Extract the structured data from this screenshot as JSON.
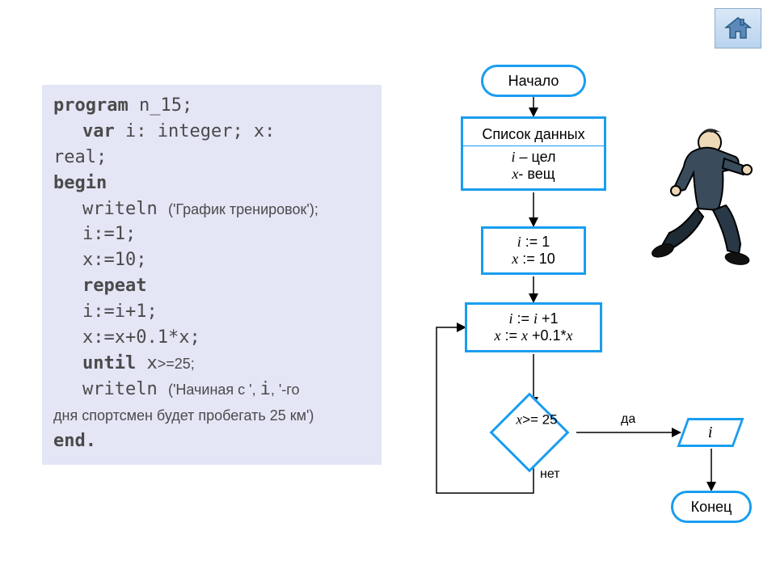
{
  "home_button": {
    "tooltip": "Домой"
  },
  "code": {
    "l1_kw": "program",
    "l1_rest": " n_15;",
    "l2_kw": "var",
    "l2_rest": " i: integer; x:",
    "l3": "real;",
    "l4_kw": "begin",
    "l5_fn": "writeln ",
    "l5_arg": "('График тренировок');",
    "l6": "i:=1;",
    "l7": "x:=10;",
    "l8_kw": "repeat",
    "l9": "i:=i+1;",
    "l10": "x:=x+0.1*x;",
    "l11_kw": "until",
    "l11_rest": " x",
    "l11_cmt": ">=25;",
    "l12_fn": "writeln ",
    "l12_arg1": "('Начиная с ', ",
    "l12_i": "i",
    "l12_arg2": ", '-го",
    "l13_cmt": "дня спортсмен будет пробегать 25 км')",
    "l14_kw": "end."
  },
  "flow": {
    "start": "Начало",
    "datalist_title": "Список данных",
    "datalist_l1_a": "i",
    "datalist_l1_b": " – цел",
    "datalist_l2_a": "x",
    "datalist_l2_b": "- вещ",
    "init_l1_a": "i",
    "init_l1_b": " := 1",
    "init_l2_a": "x",
    "init_l2_b": " := 10",
    "loop_l1_a": "i",
    "loop_l1_b": " := ",
    "loop_l1_c": "i",
    "loop_l1_d": " +1",
    "loop_l2_a": "x",
    "loop_l2_b": " := ",
    "loop_l2_c": "x",
    "loop_l2_d": " +0.1*",
    "loop_l2_e": "x",
    "cond_a": "x",
    "cond_b": ">= 25",
    "yes": "да",
    "no": "нет",
    "output_var": "i",
    "end": "Конец"
  }
}
